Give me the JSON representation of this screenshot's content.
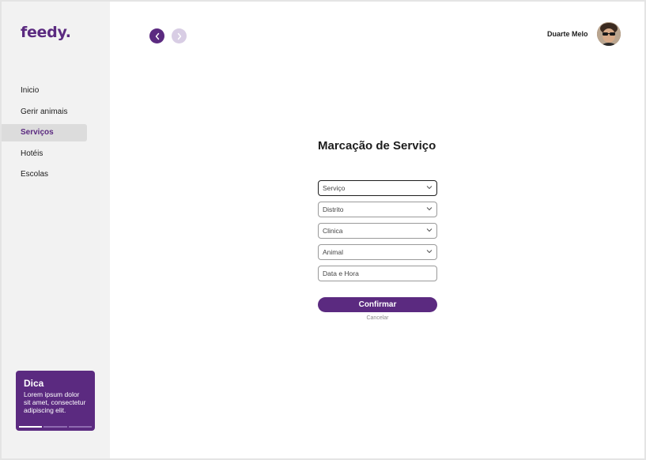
{
  "brand": {
    "logo": "feedy."
  },
  "sidebar": {
    "items": [
      {
        "label": "Inicio",
        "active": false
      },
      {
        "label": "Gerir animais",
        "active": false
      },
      {
        "label": "Serviços",
        "active": true
      },
      {
        "label": "Hotéis",
        "active": false
      },
      {
        "label": "Escolas",
        "active": false
      }
    ]
  },
  "tip": {
    "title": "Dica",
    "text": "Lorem ipsum dolor sit amet, consectetur adipiscing elit."
  },
  "header": {
    "user_name": "Duarte Melo"
  },
  "form": {
    "title": "Marcação de Serviço",
    "fields": [
      {
        "label": "Serviço",
        "type": "select"
      },
      {
        "label": "Distrito",
        "type": "select"
      },
      {
        "label": "Clinica",
        "type": "select"
      },
      {
        "label": "Animal",
        "type": "select"
      },
      {
        "label": "Data e Hora",
        "type": "input"
      }
    ],
    "confirm_label": "Confirmar",
    "cancel_label": "Cancelar"
  },
  "colors": {
    "accent": "#5b2a80",
    "accent_light": "#d8cde4",
    "sidebar_bg": "#f2f2f2"
  }
}
